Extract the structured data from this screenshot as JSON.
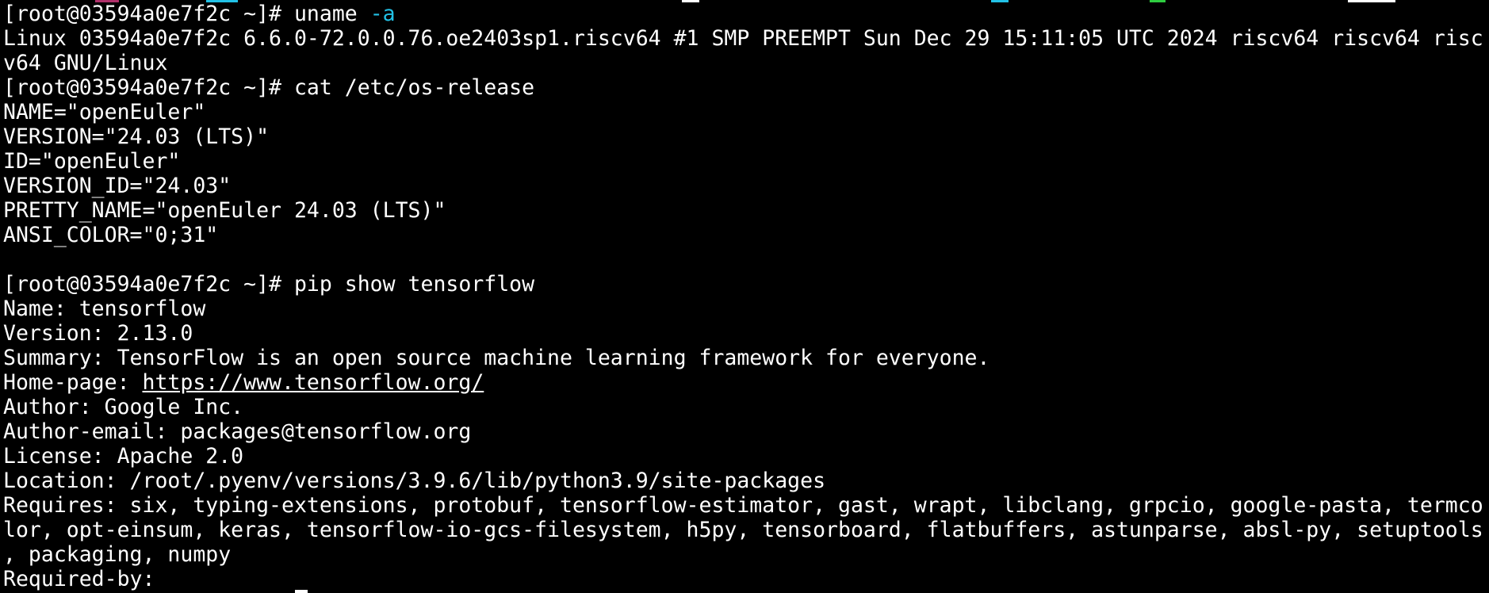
{
  "terminal": {
    "prompt": "[root@03594a0e7f2c ~]# ",
    "commands": {
      "uname": "uname",
      "uname_flag": "-a",
      "os_release": "cat /etc/os-release",
      "pip_show": "pip show tensorflow"
    },
    "uname_output": [
      "Linux 03594a0e7f2c 6.6.0-72.0.0.76.oe2403sp1.riscv64 #1 SMP PREEMPT Sun Dec 29 15:11:05 UTC 2024 riscv64 riscv64 risc",
      "v64 GNU/Linux"
    ],
    "os_release_output": [
      "NAME=\"openEuler\"",
      "VERSION=\"24.03 (LTS)\"",
      "ID=\"openEuler\"",
      "VERSION_ID=\"24.03\"",
      "PRETTY_NAME=\"openEuler 24.03 (LTS)\"",
      "ANSI_COLOR=\"0;31\"",
      ""
    ],
    "pip_output": {
      "name": "Name: tensorflow",
      "version": "Version: 2.13.0",
      "summary": "Summary: TensorFlow is an open source machine learning framework for everyone.",
      "homepage_label": "Home-page: ",
      "homepage_url": "https://www.tensorflow.org/",
      "author": "Author: Google Inc.",
      "author_email": "Author-email: packages@tensorflow.org",
      "license": "License: Apache 2.0",
      "location": "Location: /root/.pyenv/versions/3.9.6/lib/python3.9/site-packages",
      "requires": [
        "Requires: six, typing-extensions, protobuf, tensorflow-estimator, gast, wrapt, libclang, grpcio, google-pasta, termco",
        "lor, opt-einsum, keras, tensorflow-io-gcs-filesystem, h5py, tensorboard, flatbuffers, astunparse, absl-py, setuptools",
        ", packaging, numpy"
      ],
      "required_by": "Required-by:"
    }
  },
  "colors": {
    "background": "#000000",
    "foreground": "#ffffff",
    "argument": "#22c1e6",
    "strip_pink": "#b0306a",
    "strip_cyan": "#22c1e6",
    "strip_green": "#2ecc40"
  }
}
